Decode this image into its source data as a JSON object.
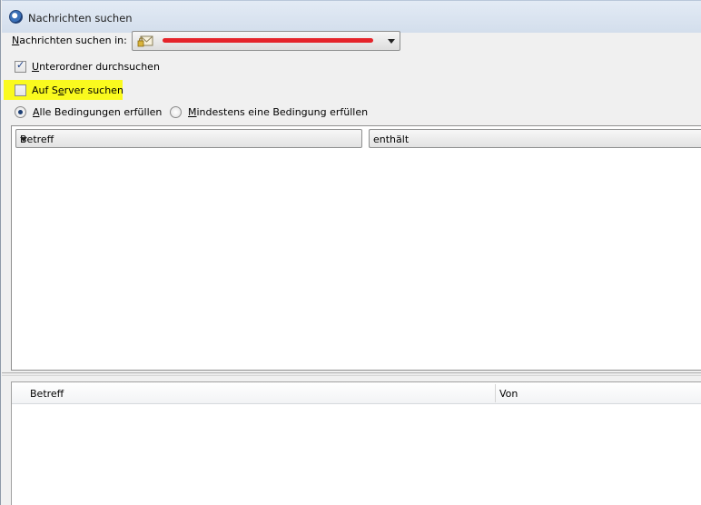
{
  "window": {
    "title": "Nachrichten suchen"
  },
  "search_in": {
    "label_access": "N",
    "label_rest": "achrichten suchen in:",
    "selected_value": ""
  },
  "options": {
    "subfolders": {
      "access": "U",
      "rest": "nterordner durchsuchen",
      "checked": true
    },
    "server": {
      "pre": "Auf S",
      "access": "e",
      "rest": "rver suchen",
      "checked": false
    }
  },
  "match": {
    "all": {
      "access": "A",
      "rest": "lle Bedingungen erfüllen",
      "selected": true
    },
    "any": {
      "access": "M",
      "rest": "indestens eine Bedingung erfüllen",
      "selected": false
    }
  },
  "condition": {
    "field": "Betreff",
    "operator": "enthält"
  },
  "results": {
    "columns": [
      "Betreff",
      "Von"
    ]
  },
  "colors": {
    "highlight": "#fafa1e",
    "redaction": "#e5242a"
  }
}
